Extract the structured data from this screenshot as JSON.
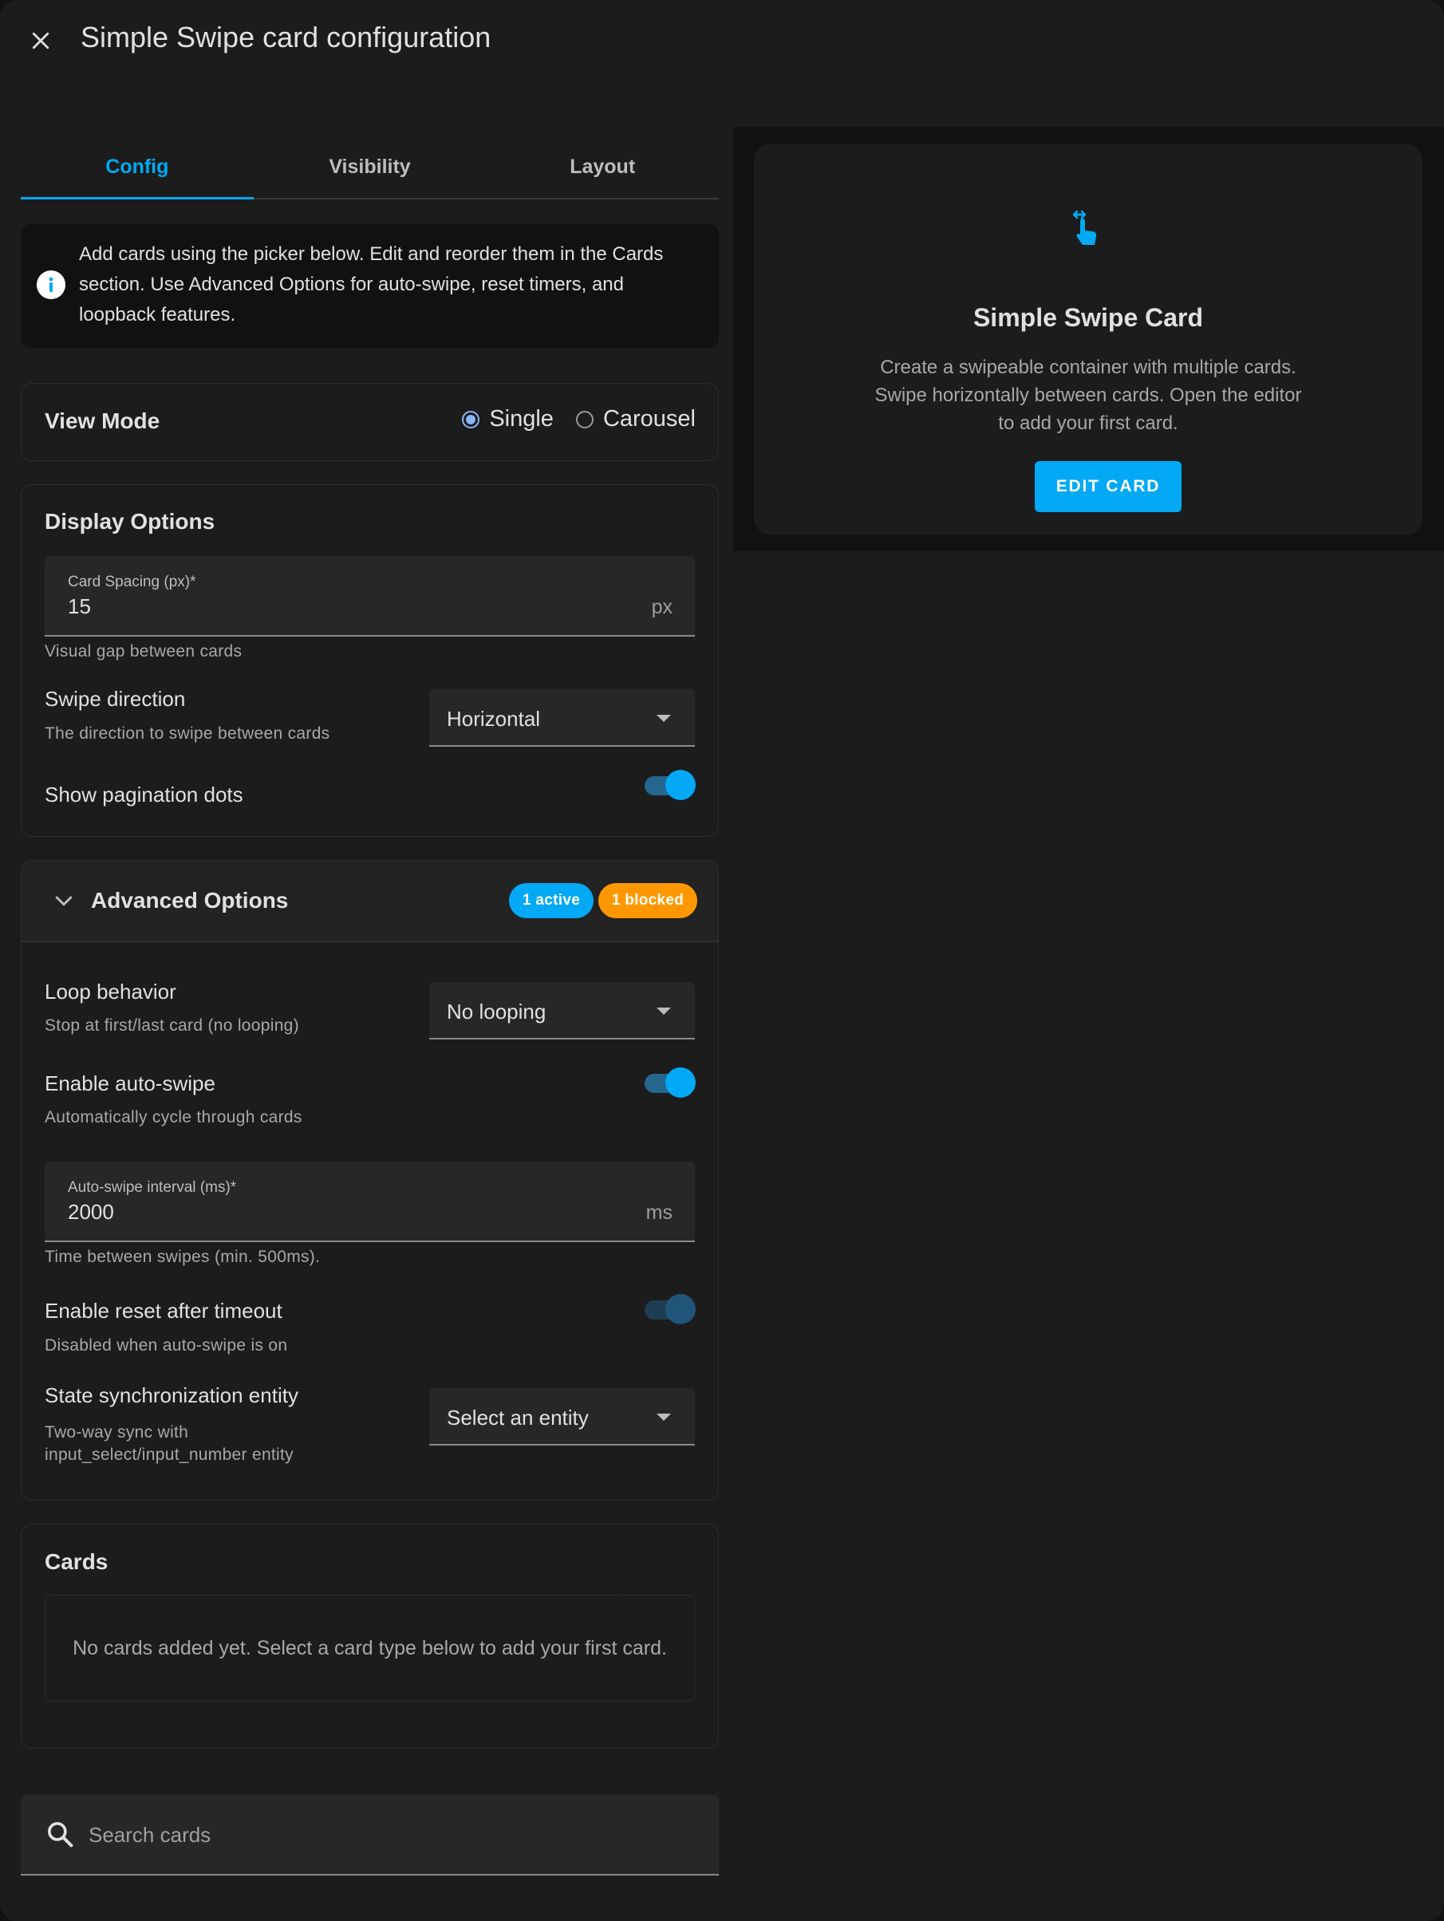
{
  "header": {
    "title": "Simple Swipe card configuration"
  },
  "tabs": [
    {
      "label": "Config",
      "active": true
    },
    {
      "label": "Visibility",
      "active": false
    },
    {
      "label": "Layout",
      "active": false
    }
  ],
  "info": {
    "text": "Add cards using the picker below. Edit and reorder them in the Cards section. Use Advanced Options for auto-swipe, reset timers, and loopback features."
  },
  "view_mode": {
    "title": "View Mode",
    "options": [
      {
        "label": "Single",
        "checked": true
      },
      {
        "label": "Carousel",
        "checked": false
      }
    ]
  },
  "display_options": {
    "title": "Display Options",
    "card_spacing": {
      "label": "Card Spacing (px)*",
      "value": "15",
      "suffix": "px",
      "helper": "Visual gap between cards"
    },
    "swipe_direction": {
      "label": "Swipe direction",
      "description": "The direction to swipe between cards",
      "value": "Horizontal"
    },
    "pagination": {
      "label": "Show pagination dots",
      "on": true
    }
  },
  "advanced": {
    "title": "Advanced Options",
    "badge_active": "1 active",
    "badge_blocked": "1 blocked",
    "loop": {
      "label": "Loop behavior",
      "description": "Stop at first/last card (no looping)",
      "value": "No looping"
    },
    "auto_swipe": {
      "label": "Enable auto-swipe",
      "description": "Automatically cycle through cards",
      "on": true
    },
    "interval": {
      "label": "Auto-swipe interval (ms)*",
      "value": "2000",
      "suffix": "ms",
      "helper": "Time between swipes (min. 500ms)."
    },
    "reset": {
      "label": "Enable reset after timeout",
      "description": "Disabled when auto-swipe is on",
      "on": true,
      "disabled": true
    },
    "sync": {
      "label": "State synchronization entity",
      "description_line1": "Two-way sync with",
      "description_line2": "input_select/input_number entity",
      "value": "Select an entity"
    }
  },
  "cards": {
    "title": "Cards",
    "empty_text": "No cards added yet. Select a card type below to add your first card."
  },
  "search": {
    "placeholder": "Search cards"
  },
  "preview": {
    "title": "Simple Swipe Card",
    "description": "Create a swipeable container with multiple cards. Swipe horizontally between cards. Open the editor to add your first card.",
    "button": "EDIT CARD"
  },
  "colors": {
    "accent": "#03a9f4",
    "warning": "#ff9800",
    "background": "#1c1c1c"
  },
  "icons": [
    "close-icon",
    "info-icon",
    "chevron-down-icon",
    "search-icon",
    "swipe-gesture-icon"
  ]
}
